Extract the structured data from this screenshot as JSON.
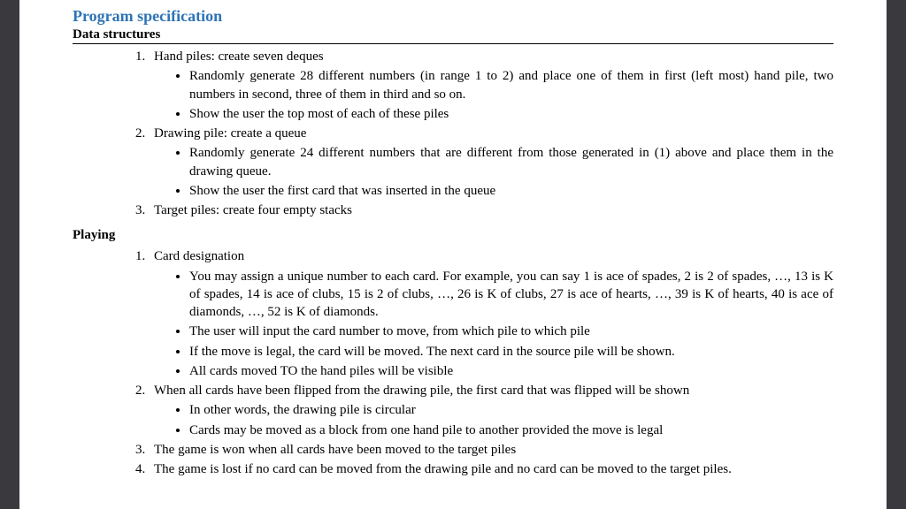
{
  "title": "Program specification",
  "sections": {
    "data_structures": {
      "heading": "Data structures",
      "items": [
        {
          "text": "Hand piles: create seven deques",
          "bullets": [
            "Randomly generate 28 different numbers (in range 1 to 2) and place one of them in first (left most) hand pile, two numbers in second, three of them in third and so on.",
            "Show the user the top most of each of these piles"
          ]
        },
        {
          "text": "Drawing pile: create a queue",
          "bullets": [
            "Randomly generate 24 different numbers that are different from those generated in (1) above and place them in the drawing queue.",
            "Show the user the first card that was inserted in the queue"
          ]
        },
        {
          "text": "Target piles: create four empty stacks",
          "bullets": []
        }
      ]
    },
    "playing": {
      "heading": "Playing",
      "items": [
        {
          "text": "Card designation",
          "bullets": [
            "You may assign a unique number to each card. For example, you can say 1 is ace of spades, 2 is 2 of spades, …, 13 is K of spades, 14 is ace of clubs, 15 is 2 of clubs, …, 26 is K of clubs, 27 is ace of hearts, …, 39 is K of hearts, 40 is ace of diamonds, …, 52 is K of diamonds.",
            "The user will input the card number to move, from which pile to which pile",
            "If the move is legal, the card will be moved. The next card in the source pile will be shown.",
            "All cards moved TO the hand piles will be visible"
          ]
        },
        {
          "text": "When all cards have been flipped from the drawing pile, the first card that was flipped will be shown",
          "bullets": [
            "In other words, the drawing pile is circular",
            "Cards may be moved as a block from one hand pile to another provided the move is legal"
          ]
        },
        {
          "text": "The game is won when all cards have been moved to the target piles",
          "bullets": []
        },
        {
          "text": "The game is lost if no card can be moved from the drawing pile and no card can be moved to the target piles.",
          "bullets": []
        }
      ]
    }
  }
}
